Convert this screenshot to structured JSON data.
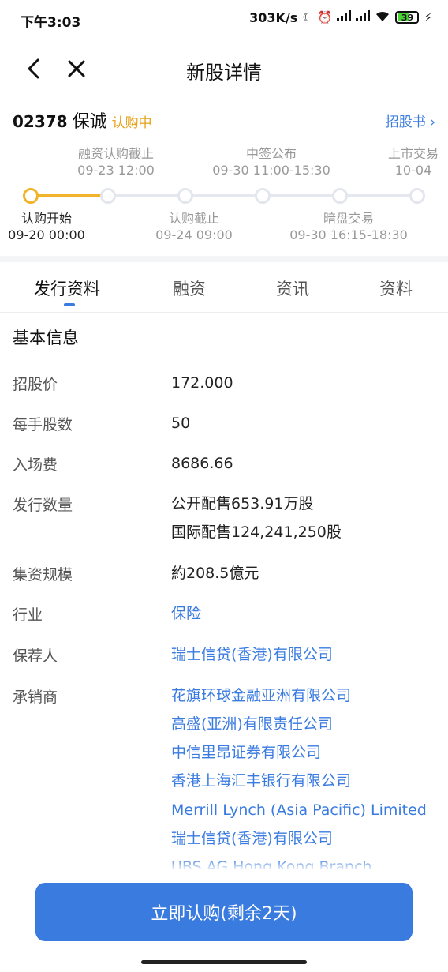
{
  "status_bar": {
    "time": "下午3:03",
    "net_speed": "303K/s",
    "battery_level": "39"
  },
  "nav": {
    "title": "新股详情"
  },
  "stock": {
    "code": "02378",
    "name": "保诚",
    "status": "认购中",
    "prospectus_label": "招股书 ›"
  },
  "timeline": {
    "top_events": [
      {
        "label": "融资认购截止",
        "time": "09-23 12:00"
      },
      {
        "label": "中签公布",
        "time": "09-30 11:00-15:30"
      },
      {
        "label": "上市交易",
        "time": "10-04"
      }
    ],
    "bottom_events": [
      {
        "label": "认购开始",
        "time": "09-20 00:00"
      },
      {
        "label": "认购截止",
        "time": "09-24 09:00"
      },
      {
        "label": "暗盘交易",
        "time": "09-30 16:15-18:30"
      }
    ]
  },
  "tabs": [
    "发行资料",
    "融资",
    "资讯",
    "资料"
  ],
  "basic_info": {
    "title": "基本信息",
    "rows": [
      {
        "label": "招股价",
        "values": [
          "172.000"
        ]
      },
      {
        "label": "每手股数",
        "values": [
          "50"
        ]
      },
      {
        "label": "入场费",
        "values": [
          "8686.66"
        ]
      },
      {
        "label": "发行数量",
        "values": [
          "公开配售653.91万股",
          "国际配售124,241,250股"
        ]
      },
      {
        "label": "集资规模",
        "values": [
          "約208.5億元"
        ]
      },
      {
        "label": "行业",
        "values": [
          "保险"
        ]
      },
      {
        "label": "保荐人",
        "values": [
          "瑞士信贷(香港)有限公司"
        ]
      },
      {
        "label": "承销商",
        "values": [
          "花旗环球金融亚洲有限公司",
          "高盛(亚洲)有限责任公司",
          "中信里昂证券有限公司",
          "香港上海汇丰银行有限公司",
          "Merrill Lynch (Asia Pacific) Limited",
          "瑞士信贷(香港)有限公司",
          "UBS AG Hong Kong Branch"
        ]
      }
    ]
  },
  "cta": {
    "label": "立即认购(剩余2天)"
  },
  "colors": {
    "accent_blue": "#3a7be0",
    "status_orange": "#e8a21a",
    "timeline_active": "#f1b42a"
  }
}
